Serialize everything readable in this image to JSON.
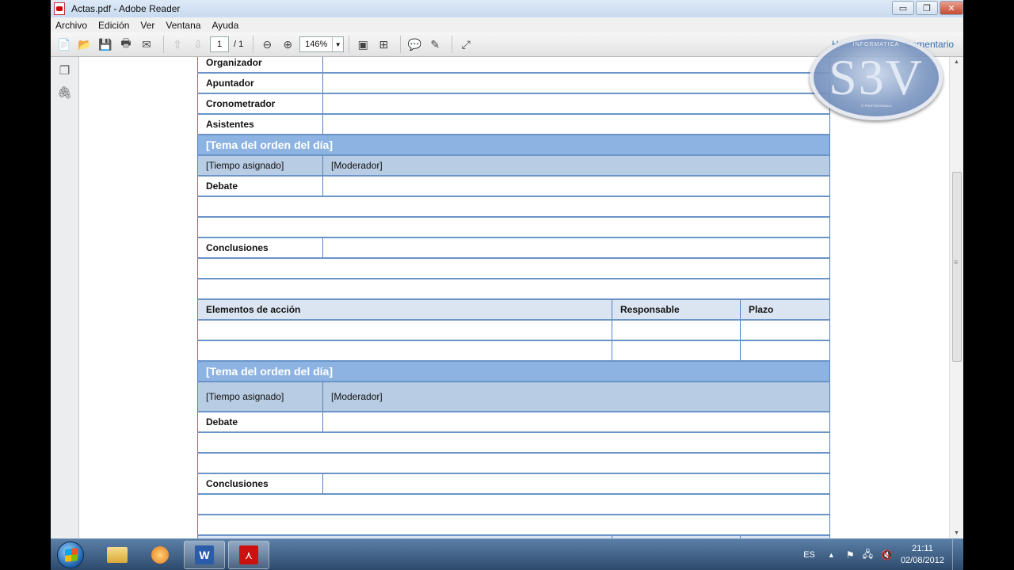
{
  "window": {
    "title": "Actas.pdf - Adobe Reader",
    "buttons": {
      "minimize": "▭",
      "maximize": "❐",
      "close": "✕"
    }
  },
  "menu": [
    "Archivo",
    "Edición",
    "Ver",
    "Ventana",
    "Ayuda"
  ],
  "toolbar": {
    "page_current": "1",
    "page_total": "/ 1",
    "zoom": "146%",
    "right_links": [
      "Herramientas",
      "Comentario"
    ]
  },
  "logo": {
    "text": "S3V",
    "top": "INFORMATICA",
    "bottom": "IT PROFESSIONALS"
  },
  "document": {
    "roles": [
      "Organizador",
      "Apuntador",
      "Cronometrador",
      "Asistentes"
    ],
    "topic_title": "[Tema del orden del día]",
    "time_label": "[Tiempo asignado]",
    "moderator_label": "[Moderador]",
    "debate_label": "Debate",
    "conclusions_label": "Conclusiones",
    "action_head": "Elementos de acción",
    "responsible_head": "Responsable",
    "deadline_head": "Plazo"
  },
  "taskbar": {
    "language": "ES",
    "time": "21:11",
    "date": "02/08/2012"
  },
  "colors": {
    "topic_band": "#8db3e2",
    "meta_band": "#b8cce4",
    "head_band": "#dbe5f1",
    "table_border": "#4f81bd"
  }
}
